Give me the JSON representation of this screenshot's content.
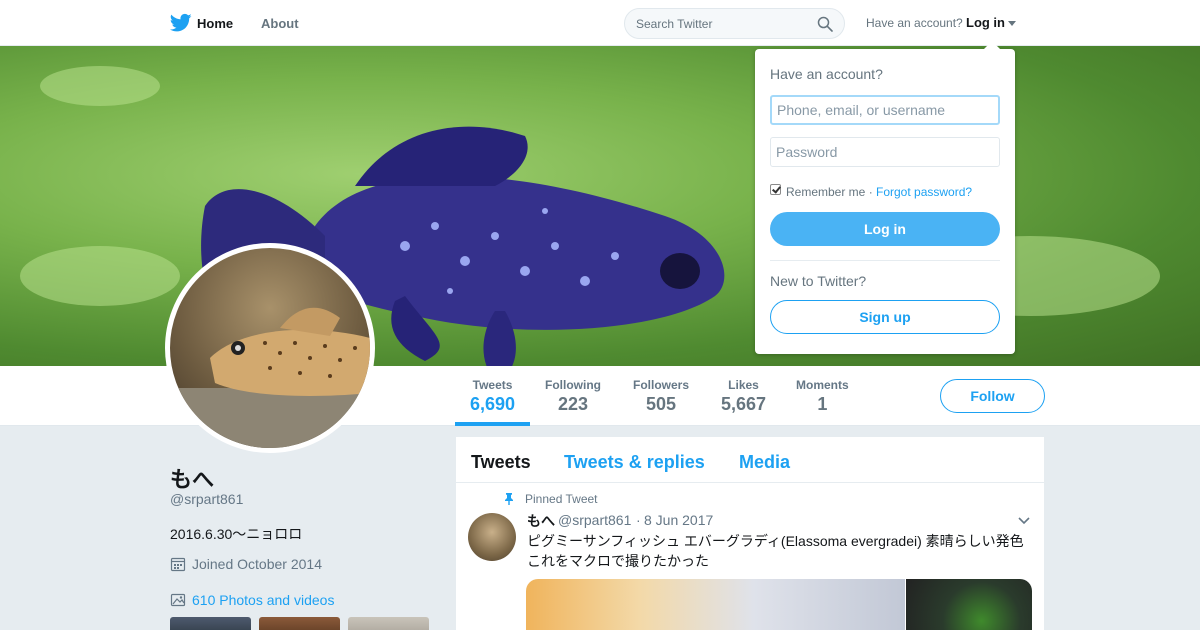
{
  "nav": {
    "home_label": "Home",
    "about_label": "About",
    "search_placeholder": "Search Twitter",
    "have_account": "Have an account?",
    "login_label": "Log in"
  },
  "profile_nav": {
    "stats": [
      {
        "label": "Tweets",
        "value": "6,690"
      },
      {
        "label": "Following",
        "value": "223"
      },
      {
        "label": "Followers",
        "value": "505"
      },
      {
        "label": "Likes",
        "value": "5,667"
      },
      {
        "label": "Moments",
        "value": "1"
      }
    ],
    "follow_label": "Follow"
  },
  "profile": {
    "display_name": "もへ",
    "screen_name": "@srpart861",
    "bio": "2016.6.30〜ニョロロ",
    "joined": "Joined October 2014",
    "photos": "610 Photos and videos"
  },
  "timeline": {
    "tabs": [
      "Tweets",
      "Tweets & replies",
      "Media"
    ],
    "pinned_label": "Pinned Tweet",
    "tweet": {
      "name": "もへ",
      "handle": "@srpart861",
      "separator": "·",
      "date": "8 Jun 2017",
      "text_line1": "ピグミーサンフィッシュ エバーグラディ(Elassoma evergradei) 素晴らしい発色",
      "text_line2": "これをマクロで撮りたかった"
    }
  },
  "login_dropdown": {
    "title": "Have an account?",
    "username_placeholder": "Phone, email, or username",
    "password_placeholder": "Password",
    "remember_label": "Remember me ·",
    "forgot_label": "Forgot password?",
    "login_button": "Log in",
    "new_label": "New to Twitter?",
    "signup_button": "Sign up"
  },
  "colors": {
    "accent": "#1da1f2",
    "login_button": "#4ab3f4",
    "background": "#e6ecf0"
  }
}
